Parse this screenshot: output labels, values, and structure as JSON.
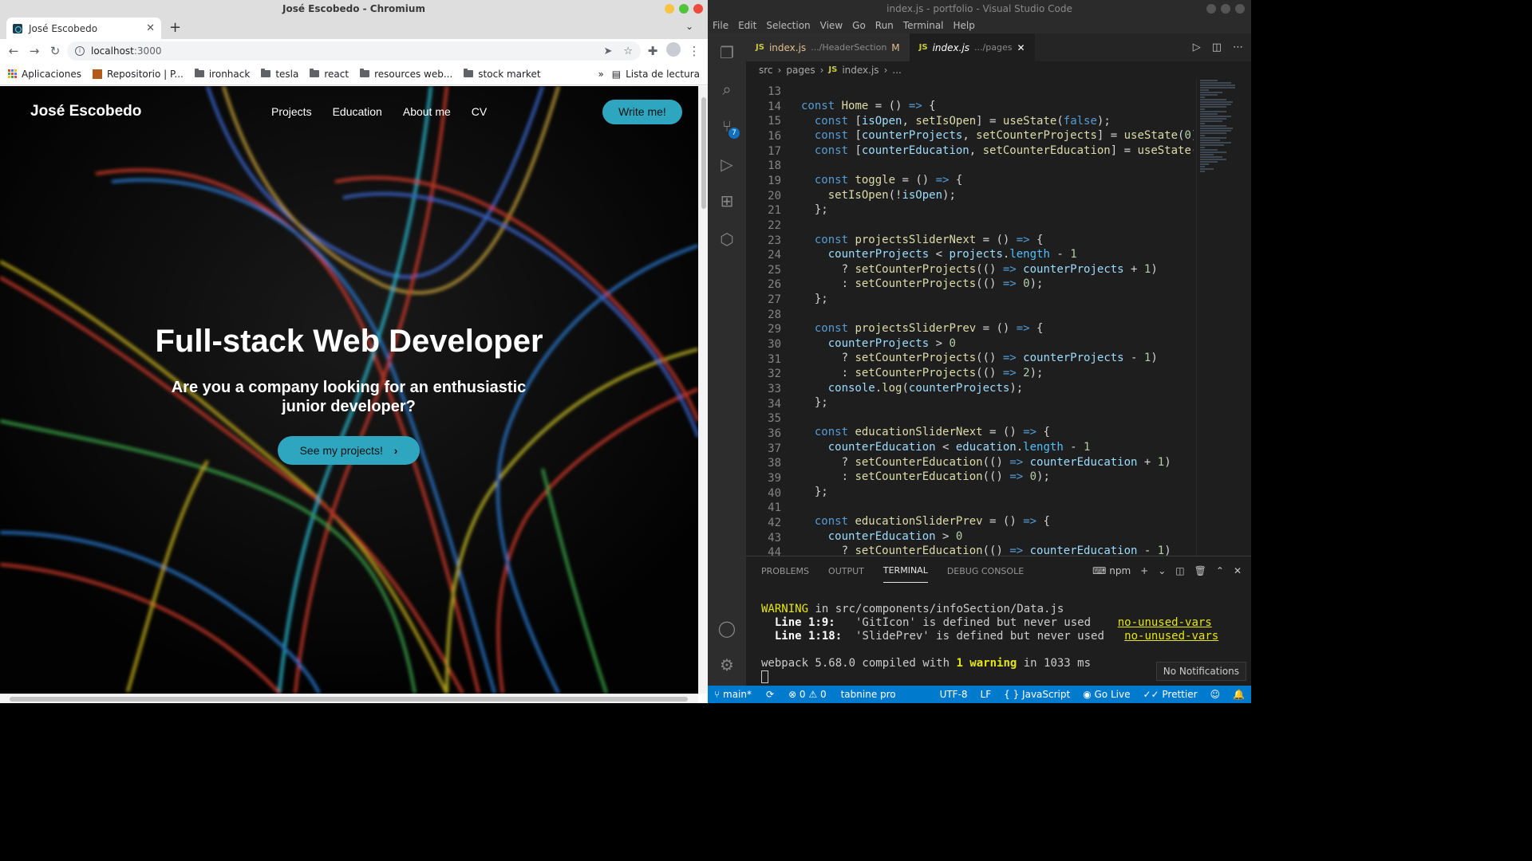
{
  "browser": {
    "window_title": "José Escobedo - Chromium",
    "tab_title": "José Escobedo",
    "url_host": "localhost",
    "url_port": ":3000",
    "bookmarks": [
      "Aplicaciones",
      "Repositorio | P...",
      "ironhack",
      "tesla",
      "react",
      "resources web...",
      "stock market"
    ],
    "bookmarks_overflow": "»",
    "reading_list": "Lista de lectura"
  },
  "site": {
    "logo": "José Escobedo",
    "nav": [
      "Projects",
      "Education",
      "About me",
      "CV"
    ],
    "cta_top": "Write me!",
    "headline": "Full-stack Web Developer",
    "subheadline": "Are you a company looking for an enthusiastic junior developer?",
    "cta_main": "See my projects!",
    "cta_arrow": "›"
  },
  "vscode": {
    "window_title": "index.js - portfolio - Visual Studio Code",
    "menu": [
      "File",
      "Edit",
      "Selection",
      "View",
      "Go",
      "Run",
      "Terminal",
      "Help"
    ],
    "scm_badge": "7",
    "tabs": [
      {
        "icon": "JS",
        "name": "index.js",
        "path": ".../HeaderSection",
        "flag": "M"
      },
      {
        "icon": "JS",
        "name": "index.js",
        "path": ".../pages",
        "flag": "✕"
      }
    ],
    "breadcrumb": [
      "src",
      "pages",
      "index.js",
      "..."
    ],
    "line_numbers": [
      "13",
      "14",
      "15",
      "16",
      "17",
      "18",
      "19",
      "20",
      "21",
      "22",
      "23",
      "24",
      "25",
      "26",
      "27",
      "28",
      "29",
      "30",
      "31",
      "32",
      "33",
      "34",
      "35",
      "36",
      "37",
      "38",
      "39",
      "40",
      "41",
      "42",
      "43",
      "44"
    ],
    "panel_tabs": [
      "PROBLEMS",
      "OUTPUT",
      "TERMINAL",
      "DEBUG CONSOLE"
    ],
    "terminal_shell": "npm",
    "terminal": {
      "warning_word": "WARNING",
      "warning_rest": " in src/components/infoSection/Data.js",
      "l1_pos": "  Line 1:9:",
      "l1_msg": "   'GitIcon' is defined but never used    ",
      "l1_rule": "no-unused-vars",
      "l2_pos": "  Line 1:18:",
      "l2_msg": "  'SlidePrev' is defined but never used   ",
      "l2_rule": "no-unused-vars",
      "compile_a": "webpack 5.68.0 compiled with ",
      "compile_b": "1 warning",
      "compile_c": " in 1033 ms"
    },
    "notification": "No Notifications",
    "status": {
      "branch": "main*",
      "sync": "⟳",
      "errors": "⊗ 0 ⚠ 0",
      "tabnine": "tabnine pro",
      "encoding": "UTF-8",
      "eol": "LF",
      "language": "JavaScript",
      "golive": "Go Live",
      "prettier": "✓✓ Prettier"
    }
  },
  "colors": {
    "accent_site": "#2fa6bf",
    "vscode_status": "#007acc",
    "vscode_keyword": "#569cd6",
    "vscode_function": "#dcdcaa",
    "vscode_variable": "#9cdcfe"
  }
}
